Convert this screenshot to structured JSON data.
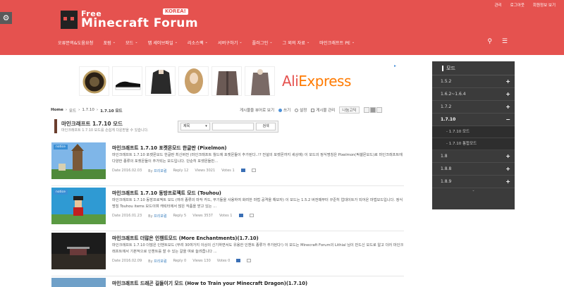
{
  "top_links": [
    "관리",
    "로그아웃",
    "회원정보 보기"
  ],
  "logo": {
    "line1": "Free",
    "line2": "Minecraft Forum",
    "badge": "KOREA!"
  },
  "nav": [
    {
      "label": "오류문의&도움요청",
      "chevron": false
    },
    {
      "label": "포럼",
      "chevron": true
    },
    {
      "label": "모드",
      "chevron": true
    },
    {
      "label": "맵 세이브파일",
      "chevron": true
    },
    {
      "label": "리소스팩",
      "chevron": true
    },
    {
      "label": "서버구하기",
      "chevron": true
    },
    {
      "label": "플러그인",
      "chevron": true
    },
    {
      "label": "그 외의 자료",
      "chevron": true
    },
    {
      "label": "마인크래프트 PE",
      "chevron": true
    }
  ],
  "ad": {
    "brand_a": "Ali",
    "brand_b": "Express"
  },
  "breadcrumb": {
    "home": "Home",
    "items": [
      "모드",
      "1.7.10"
    ],
    "current": "1.7.10 모드"
  },
  "toolbar": {
    "hint": "게시물을 뷰어로 보기",
    "opt1": "쓰기",
    "opt2": "설정",
    "opt3": "게시물 관리",
    "font": "나눔고딕"
  },
  "category": {
    "title": "마인크래프트 1.7.10 모드",
    "desc": "마인크래프트 1.7.10 모드를 손쉽게 다운받을 수 있습니다."
  },
  "search": {
    "select": "제목",
    "button": "검색"
  },
  "posts": [
    {
      "title": "마인크래프트 1.7.10 포켓몬모드 한글판 (Pixelmon)",
      "body": "마인크래프트 1.7.10 포켓몬모드 한글판 최신버전 (마인크래프트 월드에 포켓몬들이 추가된다..!? 전설의 포켓몬까지 세상에) 이 모드의 정식명칭은 Pixelmon(픽셀몬모드)로 마인크래프트에 다양한 종류의 포켓몬들이 추가되는 모드입니다. 단순히 포켓몬들만...",
      "date": "Date 2016.02.03",
      "by": "By",
      "author": "프리포럼",
      "reply": "Reply 12",
      "views": "Views 3021",
      "votes": "Votes 1",
      "notice": "notice"
    },
    {
      "title": "마인크래프트 1.7.10 동방프로젝트 모드 (Touhou)",
      "body": "마인크래프트 1.7.10 동방프로젝트 모드 (여러 종류의 마작 카드, 무기들을 사용하여 화려한 마법 공격을 해보자) 이 모드는 1.5.2 버전때부터 꾸준히 업데이트가 되어온 마법모드입니다. 정식명칭 Touhou items 모드이며 캐릭터에서 많은 작품을 받고 있는 ...",
      "date": "Date 2016.01.23",
      "by": "By",
      "author": "프리포럼",
      "reply": "Reply 5",
      "views": "Views 3537",
      "votes": "Votes 1",
      "notice": "notice"
    },
    {
      "title": "마인크래프트 더많은 인챈트모드 (More Enchantments)(1.7.10)",
      "body": "마인크래프트 1.7.10 더많은 인챈트모드 (무려 30여가지 이상의 신기하면서도 유용한 인챈트 종류가 추가된다!) 이 모드는 Minecraft Forum의 Lithial 님이 만드신 모드로 알고 더러 마인크래프트에서 기본적으로 인챈트를 할 수 있는 갈을 여로 늘려줍니다 ...",
      "date": "Date 2016.02.09",
      "by": "By",
      "author": "프리포럼",
      "reply": "Reply 0",
      "views": "Views 130",
      "votes": "Votes 0",
      "notice": ""
    },
    {
      "title": "마인크래프트 드래곤 길들이기 모드 (How to Train your Minecraft Dragon)(1.7.10)",
      "body": "",
      "date": "",
      "by": "",
      "author": "",
      "reply": "",
      "views": "",
      "votes": "",
      "notice": ""
    }
  ],
  "sidebar": {
    "title": "모드",
    "items": [
      {
        "label": "1.5.2",
        "pm": "+"
      },
      {
        "label": "1.6.2~1.6.4",
        "pm": "+"
      },
      {
        "label": "1.7.2",
        "pm": "+"
      },
      {
        "label": "1.7.10",
        "pm": "−"
      }
    ],
    "subs": [
      "- 1.7.10 모드",
      "- 1.7.10 통합모드"
    ],
    "items2": [
      {
        "label": "1.8",
        "pm": "+"
      },
      {
        "label": "1.8.8",
        "pm": "+"
      },
      {
        "label": "1.8.9",
        "pm": "+"
      }
    ]
  },
  "colors": {
    "brand": "#e5524f",
    "sidebar": "#3b3b3b",
    "link": "#3a7fbf"
  }
}
